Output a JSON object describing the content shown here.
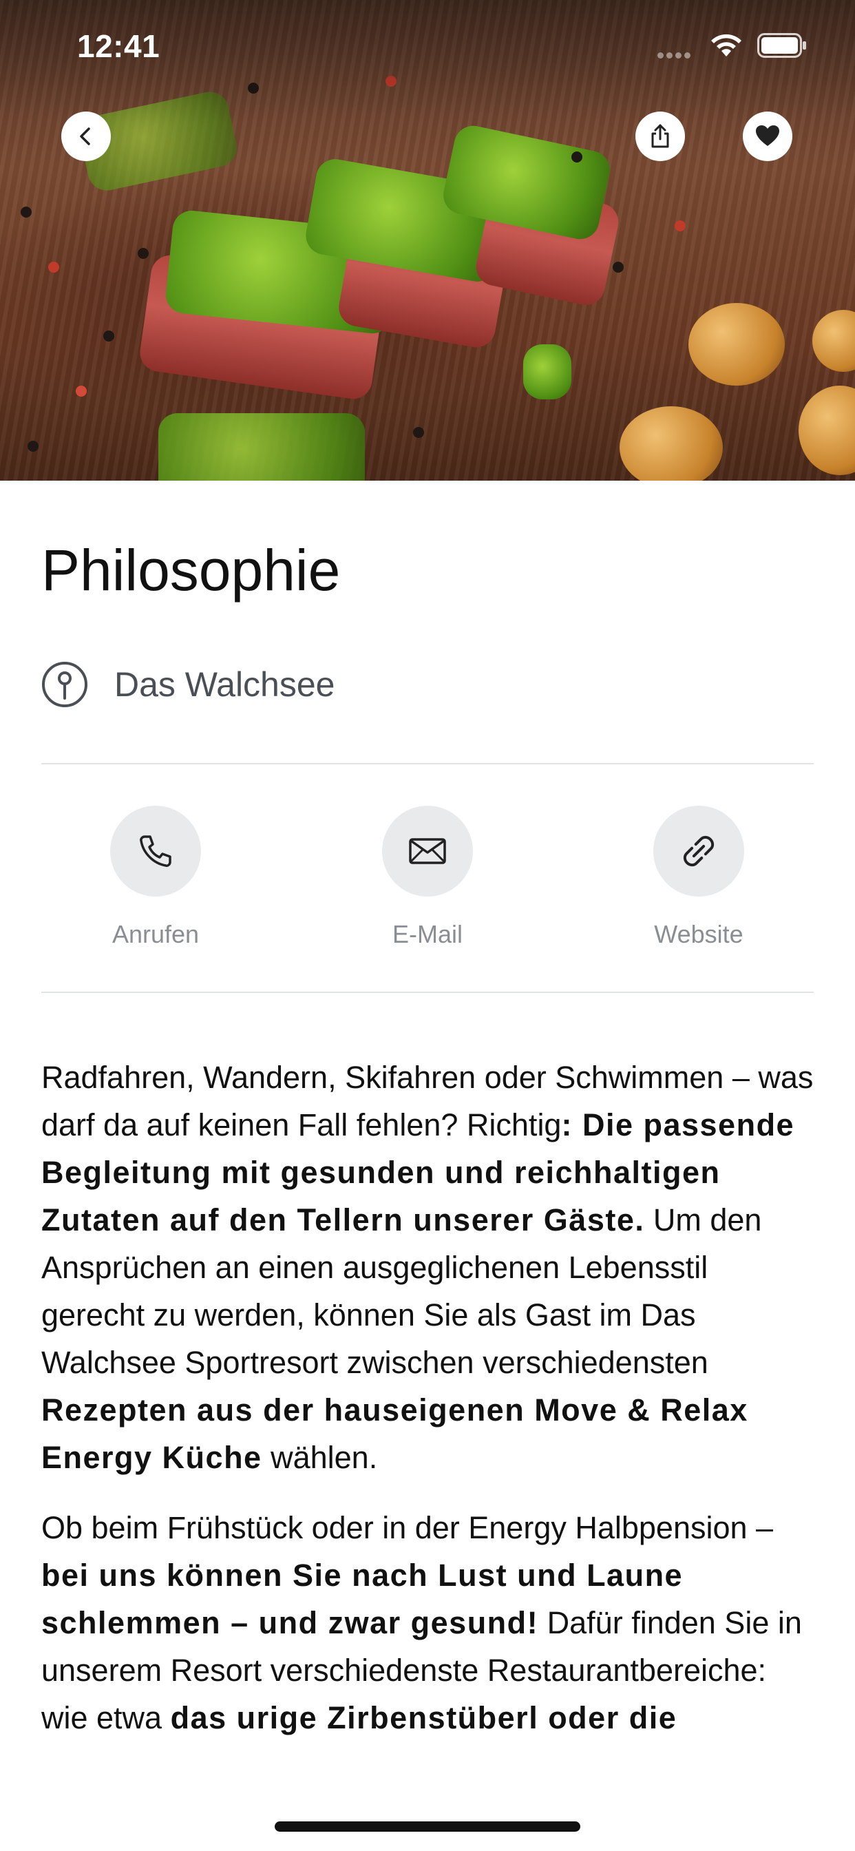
{
  "status_bar": {
    "time": "12:41"
  },
  "header": {
    "back_icon": "chevron-left-icon",
    "share_icon": "share-icon",
    "favorite_icon": "heart-icon"
  },
  "page": {
    "title": "Philosophie",
    "location": "Das Walchsee"
  },
  "actions": [
    {
      "label": "Anrufen",
      "icon": "phone-icon"
    },
    {
      "label": "E-Mail",
      "icon": "mail-icon"
    },
    {
      "label": "Website",
      "icon": "link-icon"
    }
  ],
  "content": {
    "p1": {
      "t1": "Radfahren, Wandern, Skifahren oder Schwimmen – was darf da auf keinen Fall fehlen? Richtig",
      "b1": ": Die passende Begleitung mit gesunden und reichhaltigen Zutaten auf den Tellern unserer Gäste.",
      "t2": " Um den Ansprüchen an einen ausgeglichenen Lebensstil gerecht zu werden, können Sie als Gast im Das Walchsee Sportresort zwischen verschiedensten ",
      "b2": "Rezepten aus der hauseigenen Move & Relax Energy Küche",
      "t3": " wählen."
    },
    "p2": {
      "t1": "Ob beim Frühstück oder in der Energy Halbpension  – ",
      "b1": "bei uns können Sie nach Lust und Laune schlemmen – und zwar gesund!",
      "t2": " Dafür finden Sie in unserem Resort verschiedenste Restaurantbereiche: wie etwa ",
      "b2": "das urige Zirbenstüberl oder die"
    }
  }
}
